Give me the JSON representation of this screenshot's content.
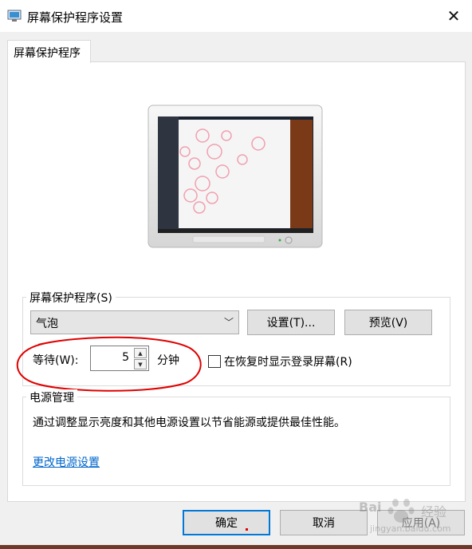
{
  "window": {
    "title": "屏幕保护程序设置"
  },
  "tab": {
    "label": "屏幕保护程序"
  },
  "screensaver": {
    "group_label": "屏幕保护程序(S)",
    "selected": "气泡",
    "settings_button": "设置(T)...",
    "preview_button": "预览(V)",
    "wait_label": "等待(W):",
    "wait_value": "5",
    "wait_unit": "分钟",
    "resume_checkbox_label": "在恢复时显示登录屏幕(R)",
    "resume_checked": false
  },
  "power": {
    "group_label": "电源管理",
    "description": "通过调整显示亮度和其他电源设置以节省能源或提供最佳性能。",
    "link": "更改电源设置"
  },
  "footer": {
    "ok_button": "确定",
    "cancel_button": "取消",
    "apply_button": "应用(A)"
  },
  "watermark": {
    "text_top": "Bai",
    "text_right": "经验",
    "url": "jingyan.baidu.com"
  },
  "colors": {
    "accent": "#0078d7",
    "annotation": "#e00000",
    "link": "#0066cc"
  }
}
